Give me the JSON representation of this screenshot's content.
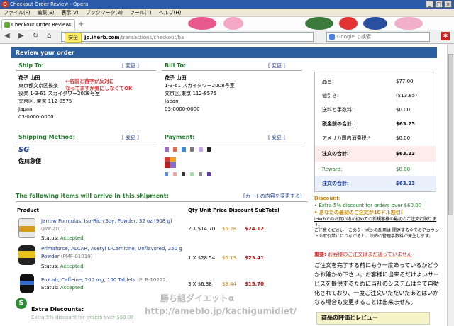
{
  "window": {
    "title": "Checkout Order Review - Opera"
  },
  "menu": [
    "ファイル(F)",
    "編集(E)",
    "表示(V)",
    "ブックマーク(B)",
    "ツール(T)",
    "ヘルプ(H)"
  ],
  "tab": {
    "title": "Checkout Order Review"
  },
  "address": {
    "security": "安全",
    "host": "jp.iherb.com",
    "path": "/transactions/checkout/ba"
  },
  "search": {
    "placeholder": "Google で検索"
  },
  "page": {
    "header": "Review your order",
    "change": "[ 変更 ]",
    "ship": {
      "title": "Ship To:",
      "name": "花子 山田",
      "lines": [
        "東京都文京区後楽",
        "後楽 1-3-61 スカイタワー2008号室",
        "文京区, 東京 112-8575",
        "Japan",
        "03-0000-0000"
      ]
    },
    "bill": {
      "title": "Bill To:",
      "name": "花子 山田",
      "lines": [
        "1-3-61 スカイタワー2008号室",
        "文京区,東京 112-8575",
        "Japan",
        "03-0000-0000"
      ]
    },
    "annotation": [
      "←名前と苗字が反対に",
      "なってますが気にしなくてOK"
    ],
    "shipping": {
      "title": "Shipping Method:",
      "carrier": "佐川急便",
      "logo": "SG"
    },
    "payment": {
      "title": "Payment:"
    },
    "summary": [
      {
        "label": "品目:",
        "value": "$77.08"
      },
      {
        "label": "値引き:",
        "value": "($13.85)"
      },
      {
        "label": "送料と手数料:",
        "value": "$0.00"
      },
      {
        "label": "税金前の合計:",
        "value": "$63.23"
      },
      {
        "label": "アメリカ国内消費税:*",
        "value": "$0.00"
      },
      {
        "label": "注文の合計:",
        "value": "$63.23"
      },
      {
        "label": "Reward:",
        "value": "$0.00"
      },
      {
        "label": "注文の合計:",
        "value": "$63.23"
      }
    ],
    "items_title": "The following items will arrive in this shipment:",
    "change_cart": "[カートの内容を変更する]",
    "columns": {
      "product": "Product",
      "rest": "Qty Unit Price Discount SubTotal"
    },
    "items": [
      {
        "name": "Jarrow Formulas, Iso-Rich Soy, Powder, 32 oz (908 g)",
        "sku": "(JRW-21017)",
        "status_label": "Status:",
        "status": "Accepted",
        "qty": "2 X $14.70",
        "discount": "$5.28",
        "subtotal": "$24.12"
      },
      {
        "name": "Primaforce, ALCAR, Acetyl L-Carnitine, Unflavored, 250 g Powder",
        "sku": "(PMF-01019)",
        "status_label": "Status:",
        "status": "Accepted",
        "qty": "1 X $28.54",
        "discount": "$5.13",
        "subtotal": "$23.41"
      },
      {
        "name": "ProLab, Caffeine, 200 mg, 100 Tablets",
        "sku": "(PLB-10222)",
        "status_label": "Status:",
        "status": "Accepted",
        "qty": "3 X $6.38",
        "discount": "$3.44",
        "subtotal": "$15.70"
      }
    ],
    "extra_discounts": "Extra Discounts:",
    "extra_faint": "Extra 5% discount for orders over $60.00",
    "discount_box": {
      "title": "Discount:",
      "bullet1": "Extra 5% discount for orders over $60.00",
      "bullet2": "あなたの最初のご注文が10ドル割引!",
      "bullet2_note": "iHerbでのお買い物が初めての新規客様の最初のご注文に限ります。",
      "note": "ご注意ください：このクーポンの乱用は 関連する全てのアカウントの取引禁止につながる上、法的の管理手数料が発生します。",
      "important_label": "重要:",
      "important": "お客様のご注文はまだ通っていません",
      "body": "ご注文を完了する前にもう一度あっているかどうかお確かめ下さい。お客様に出来るだけよいサービスを提供するために当社のシステムは全て自動化されており、一度ご注文いただいたあとはいかなる場合も変更することは出来ません。",
      "review": "商品の評価とレビュー"
    },
    "watermark": [
      "勝ち組ダイエットα",
      "http://ameblo.jp/kachigumidiet/"
    ]
  },
  "colors": {
    "accent": "#2b5fa0",
    "green": "#237a2b",
    "red": "#b81212"
  }
}
